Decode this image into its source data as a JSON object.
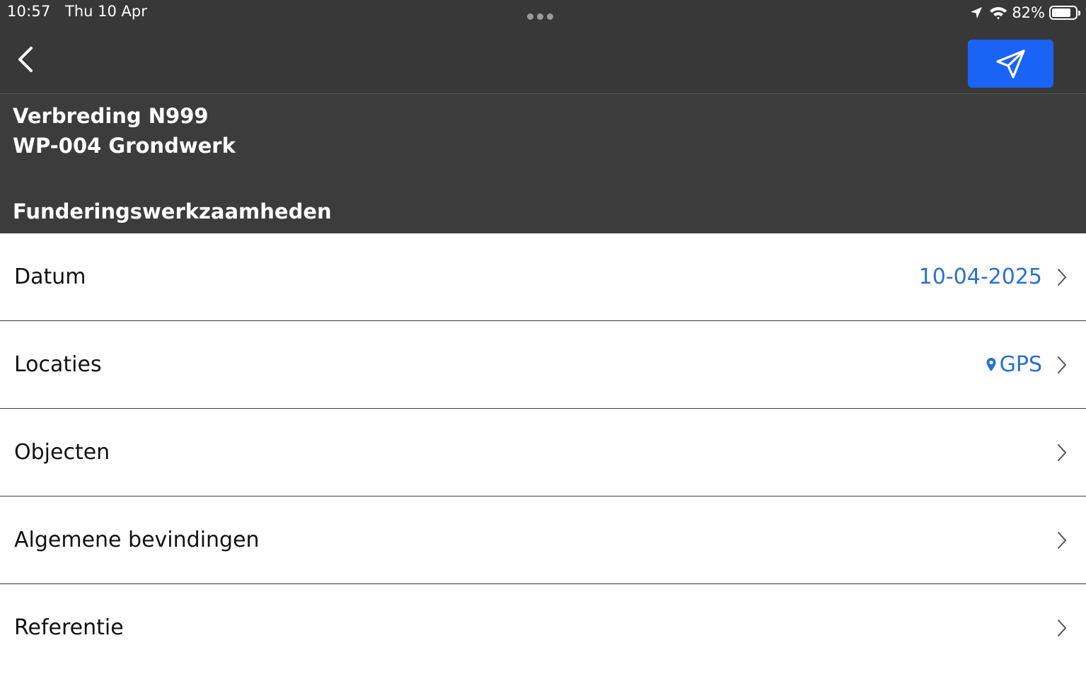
{
  "status_bar": {
    "time": "10:57",
    "date": "Thu 10 Apr",
    "battery_percent_label": "82%",
    "battery_level": 0.82,
    "icons": [
      "location-arrow-icon",
      "wifi-icon",
      "battery-icon"
    ]
  },
  "nav": {
    "back_icon": "chevron-left-icon",
    "send_icon": "paper-plane-icon",
    "accent_color": "#1a63f5"
  },
  "header": {
    "project": "Verbreding N999",
    "work_package": "WP-004 Grondwerk",
    "form_title": "Funderingswerkzaamheden"
  },
  "rows": [
    {
      "label": "Datum",
      "value": "10-04-2025",
      "icon": ""
    },
    {
      "label": "Locaties",
      "value": "GPS",
      "icon": "location-pin-icon"
    },
    {
      "label": "Objecten",
      "value": "",
      "icon": ""
    },
    {
      "label": "Algemene bevindingen",
      "value": "",
      "icon": ""
    },
    {
      "label": "Referentie",
      "value": "",
      "icon": ""
    }
  ],
  "colors": {
    "bar_background": "#383838",
    "header_background": "#3c3c3c",
    "value_text": "#2a6fd6"
  }
}
